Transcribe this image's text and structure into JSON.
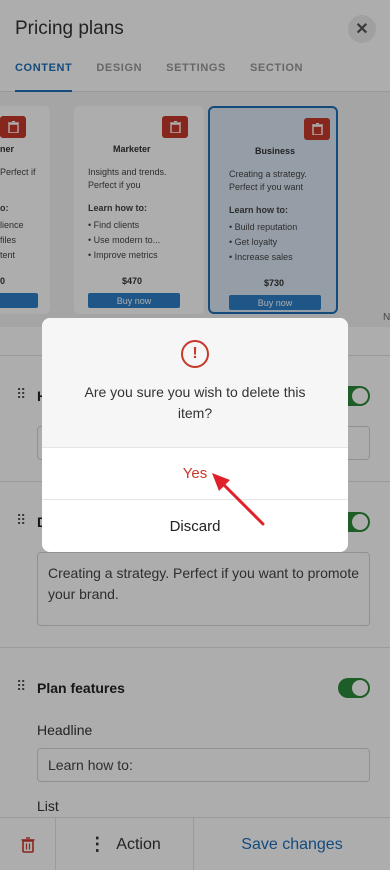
{
  "header": {
    "title": "Pricing plans",
    "close_icon": "close-icon",
    "tabs": [
      {
        "label": "CONTENT",
        "active": true
      },
      {
        "label": "DESIGN",
        "active": false
      },
      {
        "label": "SETTINGS",
        "active": false
      },
      {
        "label": "SECTION",
        "active": false
      }
    ]
  },
  "preview": {
    "cards": [
      {
        "name": "ner",
        "desc": "Perfect if",
        "learn": "o:",
        "list": [
          "lience",
          "files",
          "tent"
        ],
        "price": "0",
        "buy": "ow"
      },
      {
        "name": "Marketer",
        "desc": "Insights and trends. Perfect if you",
        "learn": "Learn how to:",
        "list": [
          "• Find clients",
          "• Use modern to...",
          "• Improve metrics"
        ],
        "price": "$470",
        "buy": "Buy now"
      },
      {
        "name": "Business",
        "desc": "Creating a strategy. Perfect if you want",
        "learn": "Learn how to:",
        "list": [
          "• Build reputation",
          "• Get loyalty",
          "• Increase sales"
        ],
        "price": "$730",
        "buy": "Buy now"
      }
    ],
    "edge_letter": "N"
  },
  "panel": {
    "headline_section_title": "H",
    "desc_section_title": "D",
    "desc_value": "Creating a strategy. Perfect if you want to promote your brand.",
    "features_title": "Plan features",
    "headline_label": "Headline",
    "headline_value": "Learn how to:",
    "list_label": "List"
  },
  "dialog": {
    "message": "Are you sure you wish to delete this item?",
    "yes_label": "Yes",
    "discard_label": "Discard"
  },
  "bottom": {
    "action_label": "Action",
    "save_label": "Save changes"
  },
  "colors": {
    "accent": "#1e6fb8",
    "danger": "#c7392b",
    "toggle_on": "#2d8a3a"
  }
}
